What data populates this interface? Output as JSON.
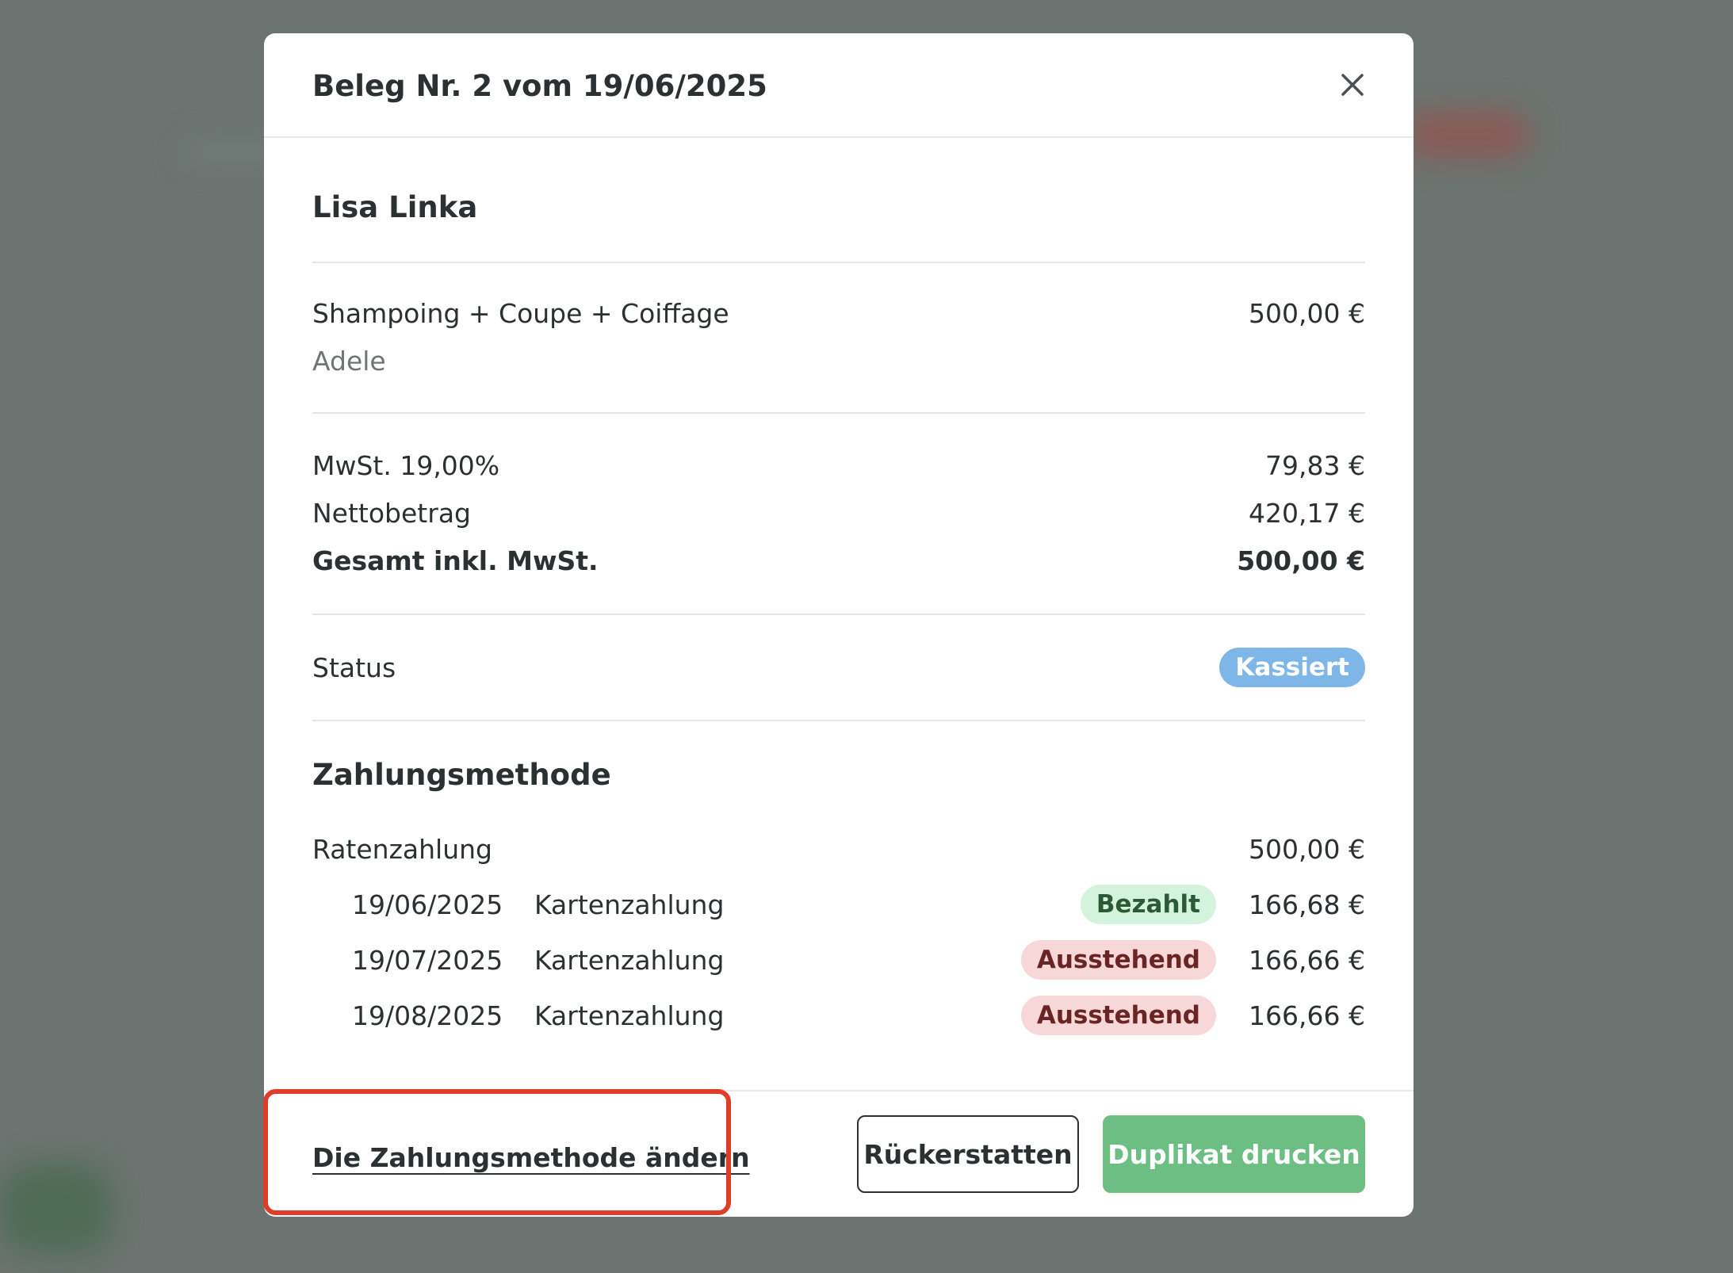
{
  "modal": {
    "title": "Beleg Nr. 2 vom 19/06/2025",
    "close_icon": "close-icon"
  },
  "customer": {
    "name": "Lisa Linka"
  },
  "service": {
    "name": "Shampoing + Coupe + Coiffage",
    "price": "500,00 €",
    "staff": "Adele"
  },
  "totals": {
    "vat_label": "MwSt. 19,00%",
    "vat_value": "79,83 €",
    "net_label": "Nettobetrag",
    "net_value": "420,17 €",
    "total_label": "Gesamt inkl. MwSt.",
    "total_value": "500,00 €"
  },
  "status": {
    "label": "Status",
    "value": "Kassiert",
    "color": "#7eb6e8"
  },
  "payment": {
    "title": "Zahlungsmethode",
    "method": "Ratenzahlung",
    "amount": "500,00 €",
    "installments": [
      {
        "date": "19/06/2025",
        "method": "Kartenzahlung",
        "status": "Bezahlt",
        "amount": "166,68 €"
      },
      {
        "date": "19/07/2025",
        "method": "Kartenzahlung",
        "status": "Ausstehend",
        "amount": "166,66 €"
      },
      {
        "date": "19/08/2025",
        "method": "Kartenzahlung",
        "status": "Ausstehend",
        "amount": "166,66 €"
      }
    ]
  },
  "footer": {
    "change_payment_label": "Die Zahlungsmethode ändern",
    "refund_label": "Rückerstatten",
    "print_duplicate_label": "Duplikat drucken",
    "primary_color": "#6cbe82",
    "highlight_color": "#e03c2a"
  }
}
